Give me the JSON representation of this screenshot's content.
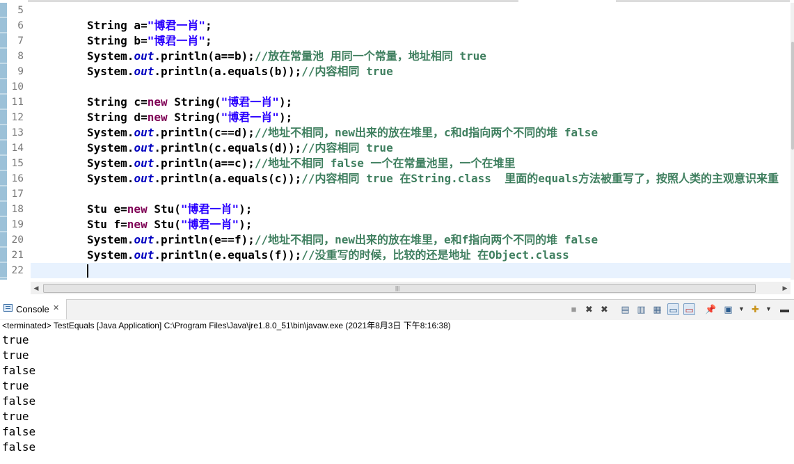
{
  "editor": {
    "line_numbers": [
      "5",
      "6",
      "7",
      "8",
      "9",
      "10",
      "11",
      "12",
      "13",
      "14",
      "15",
      "16",
      "17",
      "18",
      "19",
      "20",
      "21",
      "22"
    ]
  },
  "code": {
    "l6": {
      "t1": "String a=",
      "s1": "\"博君一肖\"",
      "t2": ";"
    },
    "l7": {
      "t1": "String b=",
      "s1": "\"博君一肖\"",
      "t2": ";"
    },
    "l8": {
      "t1": "System.",
      "f1": "out",
      "t2": ".println(a==b);",
      "c1": "//放在常量池 用同一个常量，地址相同 true"
    },
    "l9": {
      "t1": "System.",
      "f1": "out",
      "t2": ".println(a.equals(b));",
      "c1": "//内容相同 true"
    },
    "l11": {
      "t1": "String c=",
      "k1": "new",
      "t2": " String(",
      "s1": "\"博君一肖\"",
      "t3": ");"
    },
    "l12": {
      "t1": "String d=",
      "k1": "new",
      "t2": " String(",
      "s1": "\"博君一肖\"",
      "t3": ");"
    },
    "l13": {
      "t1": "System.",
      "f1": "out",
      "t2": ".println(c==d);",
      "c1": "//地址不相同，new出来的放在堆里，c和d指向两个不同的堆 false"
    },
    "l14": {
      "t1": "System.",
      "f1": "out",
      "t2": ".println(c.equals(d));",
      "c1": "//内容相同 true"
    },
    "l15": {
      "t1": "System.",
      "f1": "out",
      "t2": ".println(a==c);",
      "c1": "//地址不相同 false 一个在常量池里，一个在堆里"
    },
    "l16": {
      "t1": "System.",
      "f1": "out",
      "t2": ".println(a.equals(c));",
      "c1": "//内容相同 true 在String.class  里面的equals方法被重写了，按照人类的主观意识来重"
    },
    "l18": {
      "t1": "Stu e=",
      "k1": "new",
      "t2": " Stu(",
      "s1": "\"博君一肖\"",
      "t3": ");"
    },
    "l19": {
      "t1": "Stu f=",
      "k1": "new",
      "t2": " Stu(",
      "s1": "\"博君一肖\"",
      "t3": ");"
    },
    "l20": {
      "t1": "System.",
      "f1": "out",
      "t2": ".println(e==f);",
      "c1": "//地址不相同，new出来的放在堆里，e和f指向两个不同的堆 false"
    },
    "l21": {
      "t1": "System.",
      "f1": "out",
      "t2": ".println(e.equals(f));",
      "c1": "//没重写的时候，比较的还是地址 在Object.class"
    }
  },
  "console": {
    "tab_label": "Console",
    "tab_close": "✕",
    "status": "<terminated> TestEquals [Java Application] C:\\Program Files\\Java\\jre1.8.0_51\\bin\\javaw.exe (2021年8月3日 下午8:16:38)",
    "output": [
      "true",
      "true",
      "false",
      "true",
      "false",
      "true",
      "false",
      "false"
    ]
  },
  "toolbar_icons": [
    "terminate-icon",
    "remove-launch-icon",
    "remove-all-terminated-icon",
    "clear-console-icon",
    "scroll-lock-icon",
    "word-wrap-icon",
    "show-on-stdout-icon",
    "show-on-stderr-icon",
    "pin-console-icon",
    "display-console-icon",
    "display-console-dropdown-icon",
    "open-console-icon",
    "open-console-dropdown-icon",
    "minimize-icon"
  ],
  "colors": {
    "keyword": "#7f0055",
    "string": "#2a00ff",
    "field": "#0000c0",
    "comment": "#3f7f5f",
    "current_line": "#e8f2fe"
  }
}
